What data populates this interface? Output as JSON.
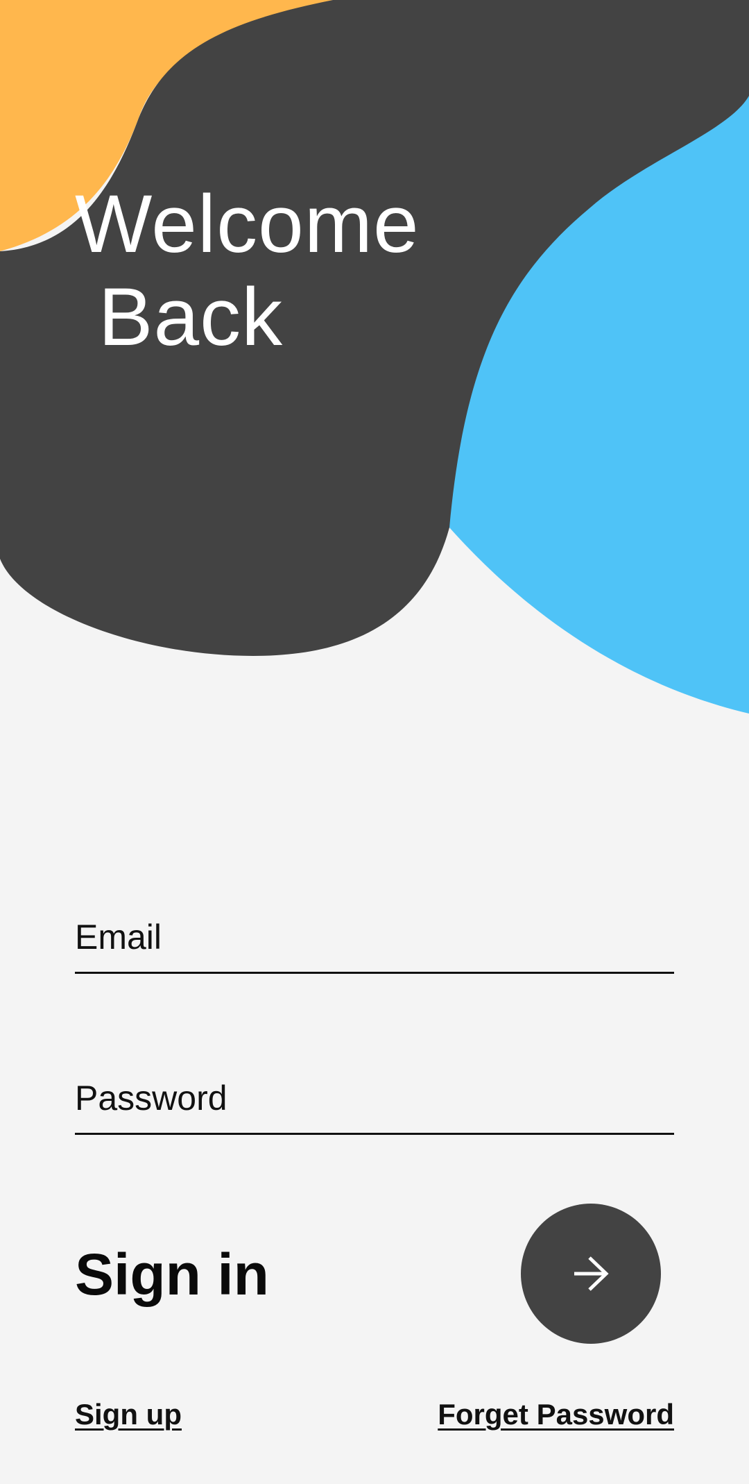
{
  "header": {
    "title_line1": "Welcome",
    "title_line2": " Back"
  },
  "form": {
    "email": {
      "placeholder": "Email",
      "value": ""
    },
    "password": {
      "placeholder": "Password",
      "value": ""
    },
    "sign_in_label": "Sign in",
    "submit_icon": "arrow-right-icon"
  },
  "links": {
    "sign_up": "Sign up",
    "forget_password": "Forget Password"
  },
  "colors": {
    "background": "#f4f4f4",
    "dark_blob": "#434343",
    "orange_blob": "#ffb74d",
    "blue_blob": "#4fc3f7",
    "text": "#111111"
  }
}
